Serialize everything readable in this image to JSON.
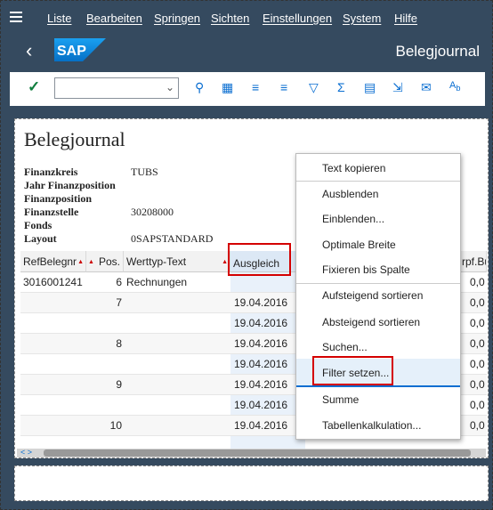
{
  "menu": {
    "items": [
      "Liste",
      "Bearbeiten",
      "Springen",
      "Sichten",
      "Einstellungen",
      "System",
      "Hilfe"
    ]
  },
  "title_bar": {
    "logo": "SAP",
    "title": "Belegjournal"
  },
  "toolbar": {
    "command_field_value": "",
    "icons": [
      "checkmark-icon",
      "chevron-down-icon",
      "zoom-icon",
      "details-icon",
      "center-align-icon",
      "align-icon",
      "filter-icon",
      "sum-icon",
      "print-preview-icon",
      "export-icon",
      "mail-icon",
      "abc-icon"
    ]
  },
  "report": {
    "title": "Belegjournal",
    "header": [
      {
        "label": "Finanzkreis",
        "value": "TUBS"
      },
      {
        "label": "Jahr Finanzposition",
        "value": ""
      },
      {
        "label": "Finanzposition",
        "value": ""
      },
      {
        "label": "Finanzstelle",
        "value": "30208000"
      },
      {
        "label": "Fonds",
        "value": ""
      },
      {
        "label": "Layout",
        "value": "0SAPSTANDARD"
      }
    ]
  },
  "grid": {
    "columns": [
      "RefBelegnr",
      "Pos.",
      "Werttyp-Text",
      "Ausgleich",
      "",
      "rpf.Bu"
    ],
    "rows": [
      {
        "ref": "3016001241",
        "pos": "6",
        "werttyp": "Rechnungen",
        "ausgleich": "",
        "amount": "0,0"
      },
      {
        "ref": "",
        "pos": "7",
        "werttyp": "",
        "ausgleich": "19.04.2016",
        "amount": "0,0"
      },
      {
        "ref": "",
        "pos": "",
        "werttyp": "",
        "ausgleich": "19.04.2016",
        "amount": "0,0"
      },
      {
        "ref": "",
        "pos": "8",
        "werttyp": "",
        "ausgleich": "19.04.2016",
        "amount": "0,0"
      },
      {
        "ref": "",
        "pos": "",
        "werttyp": "",
        "ausgleich": "19.04.2016",
        "amount": "0,0"
      },
      {
        "ref": "",
        "pos": "9",
        "werttyp": "",
        "ausgleich": "19.04.2016",
        "amount": "0,0"
      },
      {
        "ref": "",
        "pos": "",
        "werttyp": "",
        "ausgleich": "19.04.2016",
        "amount": "0,0"
      },
      {
        "ref": "",
        "pos": "10",
        "werttyp": "",
        "ausgleich": "19.04.2016",
        "amount": "0,0"
      }
    ]
  },
  "context_menu": {
    "items": [
      {
        "label": "Text kopieren"
      },
      {
        "label": "Ausblenden"
      },
      {
        "label": "Einblenden..."
      },
      {
        "label": "Optimale Breite"
      },
      {
        "label": "Fixieren bis Spalte"
      },
      {
        "label": "Aufsteigend sortieren"
      },
      {
        "label": "Absteigend sortieren"
      },
      {
        "label": "Suchen..."
      },
      {
        "label": "Filter setzen..."
      },
      {
        "label": "Summe"
      },
      {
        "label": "Tabellenkalkulation..."
      }
    ]
  },
  "colors": {
    "shell": "#354a5f",
    "accent": "#0a6ed1",
    "highlight_box": "#d40000"
  }
}
